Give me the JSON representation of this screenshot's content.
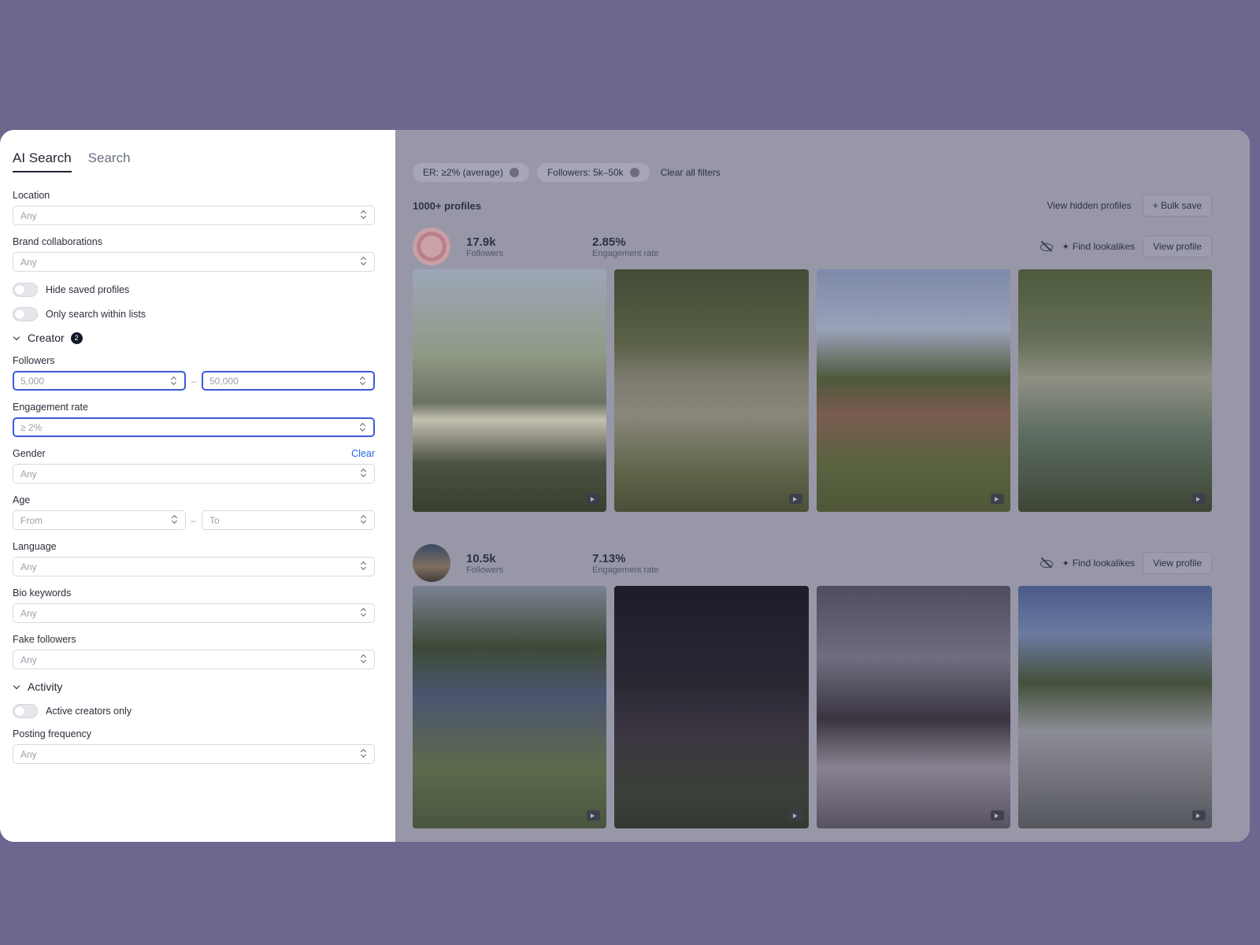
{
  "tabs": [
    {
      "label": "AI Search",
      "active": true
    },
    {
      "label": "Search",
      "active": false
    }
  ],
  "filters_panel": {
    "location": {
      "label": "Location",
      "value": "Any"
    },
    "brand_collaborations": {
      "label": "Brand collaborations",
      "value": "Any"
    },
    "hide_saved": {
      "label": "Hide saved profiles",
      "on": false
    },
    "only_lists": {
      "label": "Only search within lists",
      "on": false
    },
    "creator_section": {
      "label": "Creator",
      "badge": "2"
    },
    "followers": {
      "label": "Followers",
      "min": "5,000",
      "max": "50,000",
      "separator": "–"
    },
    "engagement_rate": {
      "label": "Engagement rate",
      "value": "≥ 2%"
    },
    "gender": {
      "label": "Gender",
      "clear": "Clear",
      "value": "Any"
    },
    "age": {
      "label": "Age",
      "from": "From",
      "to": "To",
      "separator": "–"
    },
    "language": {
      "label": "Language",
      "value": "Any"
    },
    "bio_keywords": {
      "label": "Bio keywords",
      "value": "Any"
    },
    "fake_followers": {
      "label": "Fake followers",
      "value": "Any"
    },
    "activity_section": {
      "label": "Activity"
    },
    "active_only": {
      "label": "Active creators only",
      "on": false
    },
    "posting_frequency": {
      "label": "Posting frequency",
      "value": "Any"
    }
  },
  "active_filters": [
    {
      "label": "ER: ≥2% (average)"
    },
    {
      "label": "Followers: 5k–50k"
    }
  ],
  "clear_all_label": "Clear all filters",
  "results": {
    "count": "1000+ profiles",
    "view_hidden": "View hidden profiles",
    "bulk_save": "+ Bulk save"
  },
  "profiles": [
    {
      "followers": "17.9k",
      "followers_label": "Followers",
      "er": "2.85%",
      "er_label": "Engagement rate",
      "find_lookalikes": "Find lookalikes",
      "view_profile": "View profile"
    },
    {
      "followers": "10.5k",
      "followers_label": "Followers",
      "er": "7.13%",
      "er_label": "Engagement rate",
      "find_lookalikes": "Find lookalikes",
      "view_profile": "View profile"
    }
  ],
  "icons": {
    "sparkle": "✦"
  }
}
